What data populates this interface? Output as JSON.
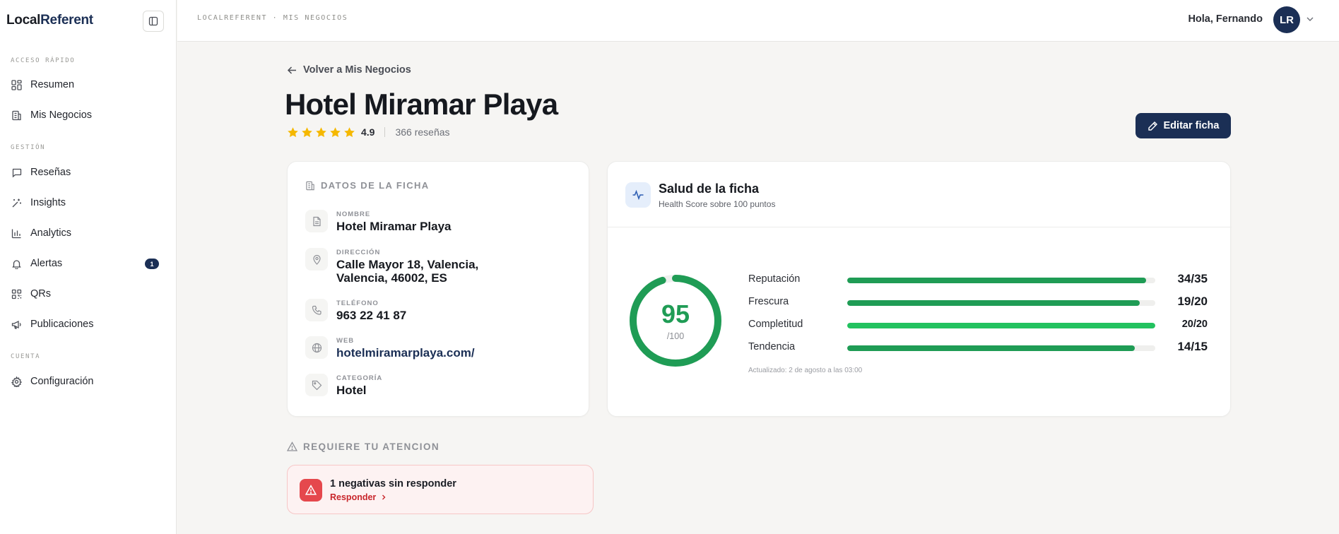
{
  "sidebar": {
    "brand_part1": "Local",
    "brand_part2": "Referent",
    "sections": {
      "quick": "ACCESO RÁPIDO",
      "management": "GESTIÓN",
      "account": "CUENTA"
    },
    "items": [
      {
        "label": "Resumen",
        "icon": "grid-icon"
      },
      {
        "label": "Mis Negocios",
        "icon": "building-icon"
      },
      {
        "label": "Reseñas",
        "icon": "message-icon"
      },
      {
        "label": "Insights",
        "icon": "sparkles-icon"
      },
      {
        "label": "Analytics",
        "icon": "bar-chart-icon"
      },
      {
        "label": "Alertas",
        "icon": "bell-icon",
        "badge": "1"
      },
      {
        "label": "QRs",
        "icon": "qr-icon"
      },
      {
        "label": "Publicaciones",
        "icon": "megaphone-icon"
      },
      {
        "label": "Configuración",
        "icon": "gear-icon"
      }
    ]
  },
  "header": {
    "breadcrumb": "LOCALREFERENT · MIS NEGOCIOS",
    "greeting": "Hola, Fernando",
    "avatar_initials": "LR"
  },
  "main": {
    "back_link": "Volver a Mis Negocios",
    "title": "Hotel Miramar Playa",
    "rating": "4.9",
    "rating_stars": 5,
    "review_count": "366 reseñas",
    "edit_button": "Editar ficha"
  },
  "datos": {
    "heading": "DATOS DE LA FICHA",
    "fields": [
      {
        "label": "NOMBRE",
        "value": "Hotel Miramar Playa",
        "icon": "document-icon"
      },
      {
        "label": "DIRECCIÓN",
        "value_line1": "Calle Mayor 18, Valencia,",
        "value_line2": "Valencia, 46002, ES",
        "icon": "map-pin-icon"
      },
      {
        "label": "TELÉFONO",
        "value": "963 22 41 87",
        "icon": "phone-icon"
      },
      {
        "label": "WEB",
        "value": "hotelmiramarplaya.com/",
        "icon": "globe-icon"
      },
      {
        "label": "CATEGORÍA",
        "value": "Hotel",
        "icon": "tag-icon"
      }
    ]
  },
  "salud": {
    "title": "Salud de la ficha",
    "subtitle": "Health Score sobre 100 puntos",
    "score": "95",
    "score_max": "/100",
    "score_fraction": 0.95,
    "metrics": [
      {
        "label": "Reputación",
        "value": "34/35",
        "fraction": 0.971
      },
      {
        "label": "Frescura",
        "value": "19/20",
        "fraction": 0.95
      },
      {
        "label": "Completitud",
        "value": "20/20",
        "fraction": 1.0
      },
      {
        "label": "Tendencia",
        "value": "14/15",
        "fraction": 0.933
      }
    ],
    "updated": "Actualizado: 2 de agosto a las 03:00"
  },
  "attention": {
    "heading": "REQUIERE TU ATENCION",
    "alert_title": "1 negativas sin responder",
    "alert_action": "Responder"
  },
  "colors": {
    "brand": "#1b2f55",
    "success": "#1f9c55",
    "danger": "#e5484d",
    "star": "#f5b800"
  }
}
